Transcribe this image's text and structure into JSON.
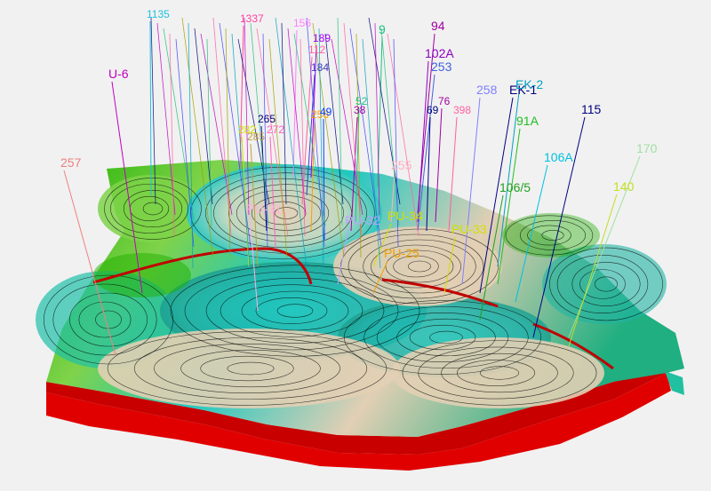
{
  "scene": {
    "background_color": "#f1f1f1",
    "model_base_color": "#e00000",
    "surface_colors": [
      "#1fb000",
      "#7fd34a",
      "#1fc8c0",
      "#e2cfb4"
    ],
    "fault_color": "#c00000",
    "contour_color": "#000000"
  },
  "wells": [
    {
      "label": "U-6",
      "color": "#c000c0"
    },
    {
      "label": "257",
      "color": "#f08080"
    },
    {
      "label": "9",
      "color": "#20c080"
    },
    {
      "label": "94",
      "color": "#a000a0"
    },
    {
      "label": "102A",
      "color": "#9000c0"
    },
    {
      "label": "253",
      "color": "#4060e0"
    },
    {
      "label": "258",
      "color": "#8080ff"
    },
    {
      "label": "EK-1",
      "color": "#000080"
    },
    {
      "label": "EK-2",
      "color": "#00a0c0"
    },
    {
      "label": "115",
      "color": "#000080"
    },
    {
      "label": "91A",
      "color": "#20c020"
    },
    {
      "label": "106A",
      "color": "#00c0e0"
    },
    {
      "label": "170",
      "color": "#a0e0a0"
    },
    {
      "label": "106/5",
      "color": "#20a020"
    },
    {
      "label": "140",
      "color": "#c0e020"
    },
    {
      "label": "PU-33",
      "color": "#d0e000"
    },
    {
      "label": "PU-34",
      "color": "#d0e000"
    },
    {
      "label": "PU-25",
      "color": "#f0a000"
    },
    {
      "label": "PU-32",
      "color": "#c0a0ff"
    },
    {
      "label": "PU-31",
      "color": "#ffb0e0"
    },
    {
      "label": "255",
      "color": "#ffb0c0"
    },
    {
      "label": "265",
      "color": "#000080"
    },
    {
      "label": "272",
      "color": "#ff60c0"
    },
    {
      "label": "282",
      "color": "#d0e000"
    },
    {
      "label": "285",
      "color": "#c0a040"
    },
    {
      "label": "253",
      "color": "#ffa000"
    },
    {
      "label": "49",
      "color": "#0040ff"
    },
    {
      "label": "38",
      "color": "#a000a0"
    },
    {
      "label": "52",
      "color": "#20c080"
    },
    {
      "label": "69",
      "color": "#000080"
    },
    {
      "label": "76",
      "color": "#a000a0"
    },
    {
      "label": "398",
      "color": "#ff60a0"
    },
    {
      "label": "189",
      "color": "#a000ff"
    },
    {
      "label": "184",
      "color": "#4040c0"
    },
    {
      "label": "112",
      "color": "#ff60a0"
    },
    {
      "label": "156",
      "color": "#ff80ff"
    },
    {
      "label": "1337",
      "color": "#ff40a0"
    },
    {
      "label": "1135",
      "color": "#20c0e0"
    }
  ]
}
